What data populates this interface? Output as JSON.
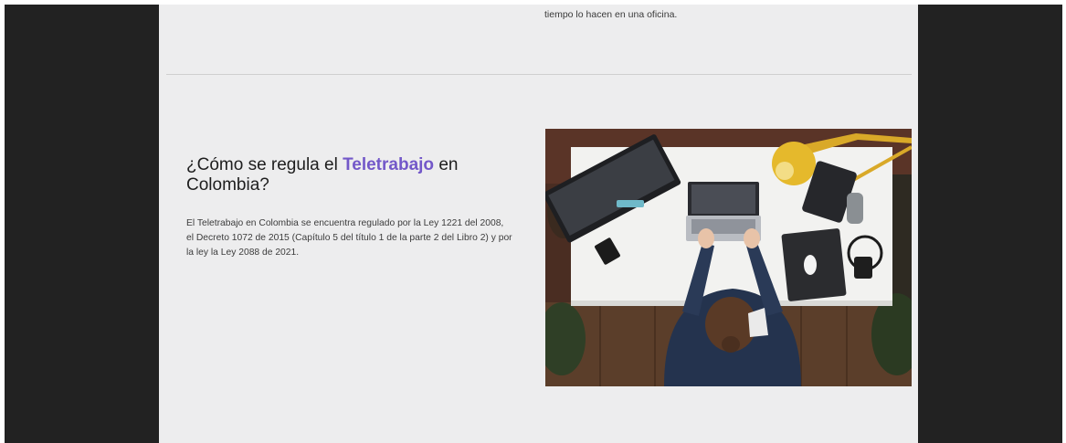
{
  "previous_section": {
    "text_fragment": "tiempo lo hacen en una oficina."
  },
  "section": {
    "heading_before": "¿Cómo se regula el ",
    "heading_accent": "Teletrabajo",
    "heading_after": " en Colombia?",
    "body": "El Teletrabajo en Colombia se encuentra regulado por la Ley 1221 del 2008, el Decreto 1072 de 2015 (Capítulo 5 del título 1 de la parte 2 del Libro 2) y por la ley la Ley 2088 de 2021."
  },
  "colors": {
    "accent": "#7358c9",
    "page_background": "#ededee",
    "outer_background": "#222222"
  },
  "image": {
    "icon": "overhead-desk-workspace-photo"
  }
}
